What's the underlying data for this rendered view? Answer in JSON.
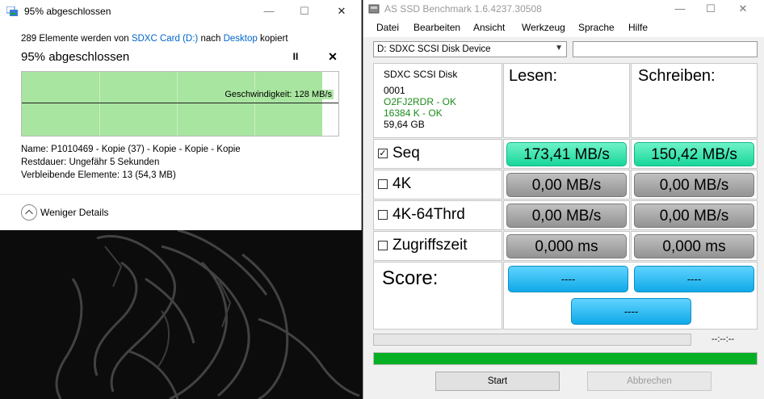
{
  "copy_dialog": {
    "title": "95% abgeschlossen",
    "summary_prefix": "289 Elemente werden von",
    "source": "SDXC Card (D:)",
    "summary_middle": "nach",
    "destination": "Desktop",
    "summary_suffix": "kopiert",
    "percent_text": "95% abgeschlossen",
    "progress_fraction": 0.95,
    "speed_label": "Geschwindigkeit: 128 MB/s",
    "name_line": "Name:  P1010469 - Kopie (37) - Kopie - Kopie - Kopie",
    "remaining_time_line": "Restdauer:  Ungefähr 5 Sekunden",
    "remaining_items_line": "Verbleibende Elemente:  13 (54,3 MB)",
    "less_details": "Weniger Details",
    "pause_glyph": "II",
    "cancel_glyph": "✕",
    "window_controls": {
      "minimize": "—",
      "maximize": "☐",
      "close": "✕"
    }
  },
  "ssd": {
    "title": "AS SSD Benchmark 1.6.4237.30508",
    "window_controls": {
      "minimize": "—",
      "maximize": "☐",
      "close": "✕"
    },
    "menu": [
      "Datei",
      "Bearbeiten",
      "Ansicht",
      "Werkzeug",
      "Sprache",
      "Hilfe"
    ],
    "drive_selected": "D:  SDXC SCSI Disk Device",
    "drive_info": {
      "name": "SDXC SCSI Disk",
      "firmware": "0001",
      "driver_status": "O2FJ2RDR - OK",
      "alignment_status": "16384 K - OK",
      "capacity": "59,64 GB"
    },
    "headers": {
      "read": "Lesen:",
      "write": "Schreiben:"
    },
    "rows": [
      {
        "label": "Seq",
        "checked": true,
        "read": "173,41 MB/s",
        "write": "150,42 MB/s"
      },
      {
        "label": "4K",
        "checked": false,
        "read": "0,00 MB/s",
        "write": "0,00 MB/s"
      },
      {
        "label": "4K-64Thrd",
        "checked": false,
        "read": "0,00 MB/s",
        "write": "0,00 MB/s"
      },
      {
        "label": "Zugriffszeit",
        "checked": false,
        "read": "0,000 ms",
        "write": "0,000 ms"
      }
    ],
    "score_label": "Score:",
    "score": {
      "read": "----",
      "write": "----",
      "total": "----"
    },
    "time_readout": "--:--:--",
    "progress_fraction": 1.0,
    "colors": {
      "result_active": "#18d69a",
      "result_idle": "#939393",
      "score": "#10a9e8",
      "progress": "#06b025"
    },
    "buttons": {
      "start": "Start",
      "abort": "Abbrechen"
    }
  }
}
